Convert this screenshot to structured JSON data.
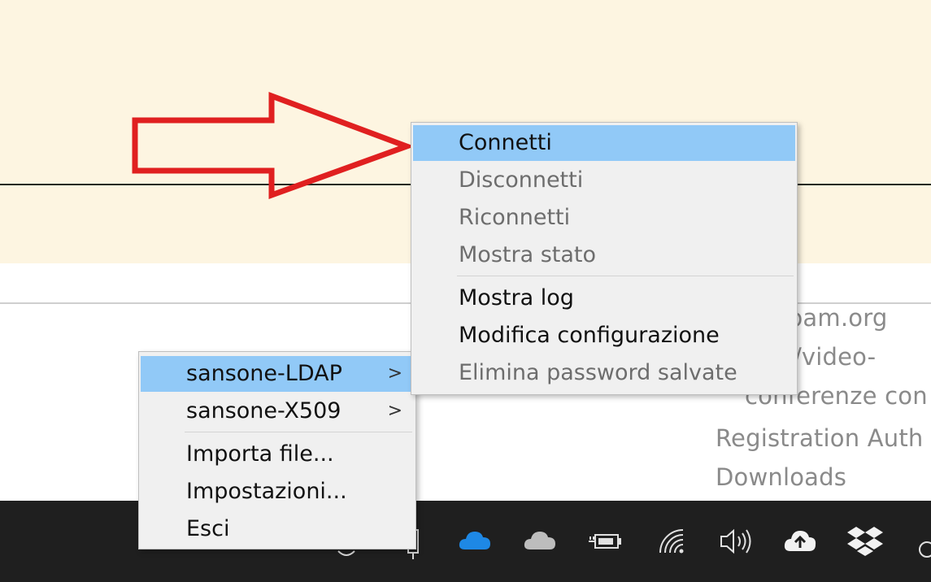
{
  "background": {
    "banner_color": "#fdf5e1",
    "links": [
      "roam.org",
      "o/video-",
      "conferenze con",
      "Registration Auth",
      "Downloads"
    ]
  },
  "main_menu": {
    "items": [
      {
        "label": "sansone-LDAP",
        "has_submenu": true,
        "highlighted": true
      },
      {
        "label": "sansone-X509",
        "has_submenu": true
      },
      {
        "label": "Importa file..."
      },
      {
        "label": "Impostazioni..."
      },
      {
        "label": "Esci"
      }
    ],
    "submenu_chevron": ">"
  },
  "submenu": {
    "items": [
      {
        "label": "Connetti",
        "enabled": true,
        "highlighted": true
      },
      {
        "label": "Disconnetti",
        "enabled": false
      },
      {
        "label": "Riconnetti",
        "enabled": false
      },
      {
        "label": "Mostra stato",
        "enabled": false
      },
      {
        "label": "Mostra log",
        "enabled": true
      },
      {
        "label": "Modifica configurazione",
        "enabled": true
      },
      {
        "label": "Elimina password salvate",
        "enabled": false
      }
    ]
  },
  "annotation": {
    "arrow_color": "#e02020"
  },
  "taskbar": {
    "color": "#1f1f1f",
    "tray_icons": [
      "onedrive-blue-icon",
      "onedrive-gray-icon",
      "battery-charging-icon",
      "wifi-icon",
      "volume-icon",
      "cloud-upload-icon",
      "dropbox-icon"
    ]
  }
}
